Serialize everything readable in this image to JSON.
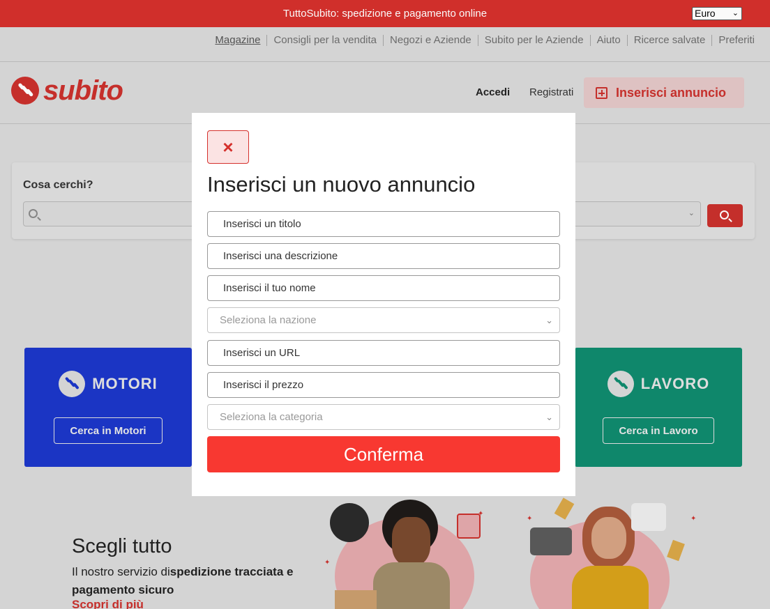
{
  "topbar": {
    "message": "TuttoSubito: spedizione e pagamento online",
    "currency": "Euro"
  },
  "utility_links": [
    "Magazine",
    "Consigli per la vendita",
    "Negozi e Aziende",
    "Subito per le Aziende",
    "Aiuto",
    "Ricerce salvate",
    "Preferiti"
  ],
  "header": {
    "logo_text": "subito",
    "login": "Accedi",
    "register": "Registrati",
    "insert_ad": "Inserisci annuncio"
  },
  "search": {
    "label": "Cosa cerchi?"
  },
  "categories": {
    "motori": {
      "title": "MOTORI",
      "button": "Cerca in Motori"
    },
    "lavoro": {
      "title": "LAVORO",
      "button": "Cerca in Lavoro"
    }
  },
  "promo": {
    "title": "Scegli tutto",
    "text_start": "Il nostro servizio di",
    "text_bold": "spedizione tracciata e pagamento sicuro",
    "link": "Scopri di più"
  },
  "modal": {
    "close_icon": "×",
    "title": "Inserisci un nuovo annuncio",
    "fields": {
      "title": "Inserisci un titolo",
      "description": "Inserisci una descrizione",
      "name": "Inserisci il tuo nome",
      "country": "Seleziona la nazione",
      "url": "Inserisci un URL",
      "price": "Inserisci il prezzo",
      "category": "Seleziona la categoria"
    },
    "confirm": "Conferma"
  },
  "colors": {
    "brand_red": "#d5302c",
    "confirm_red": "#f83831",
    "motori_blue": "#1c37c8",
    "lavoro_green": "#108a6e"
  }
}
